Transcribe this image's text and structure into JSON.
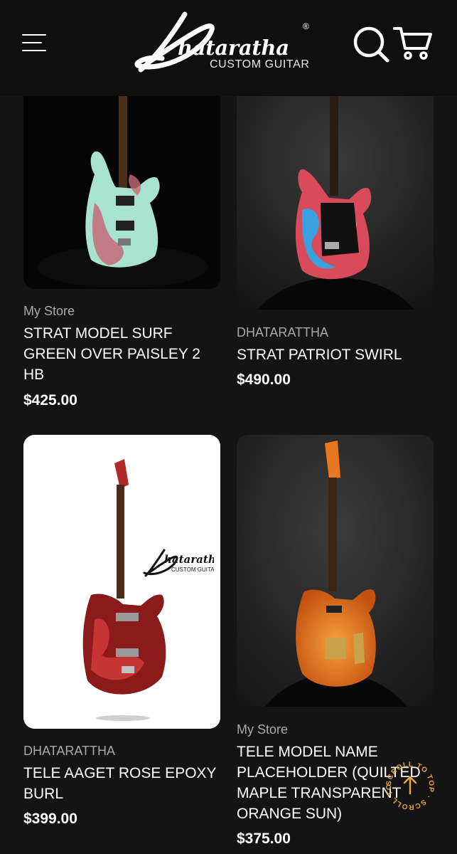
{
  "header": {
    "logo_word": "hataratha",
    "logo_subtitle": "CUSTOM GUITAR",
    "logo_reg": "®"
  },
  "products": [
    {
      "vendor": "My Store",
      "title": "STRAT MODEL SURF GREEN OVER PAISLEY 2 HB",
      "price": "$425.00",
      "body_color": "#a8e3d0"
    },
    {
      "vendor": "DHATARATTHA",
      "title": "STRAT PATRIOT SWIRL",
      "price": "$490.00",
      "body_color": "#d94b5b"
    },
    {
      "vendor": "DHATARATTHA",
      "title": "TELE AAGET ROSE EPOXY BURL",
      "price": "$399.00",
      "body_color": "#8b1a1a"
    },
    {
      "vendor": "My Store",
      "title": "TELE MODEL NAME PLACEHOLDER (QUILTED MAPLE TRANSPARENT ORANGE SUN)",
      "price": "$375.00",
      "body_color": "#e8771e"
    }
  ],
  "scroll_top": {
    "label": "SCROLL TO TOP · SCROLL TO TOP ·",
    "color": "#e8a23a"
  },
  "colors": {
    "background": "#141414",
    "header": "#0f0f0f",
    "vendor_text": "#a9a9a9"
  }
}
